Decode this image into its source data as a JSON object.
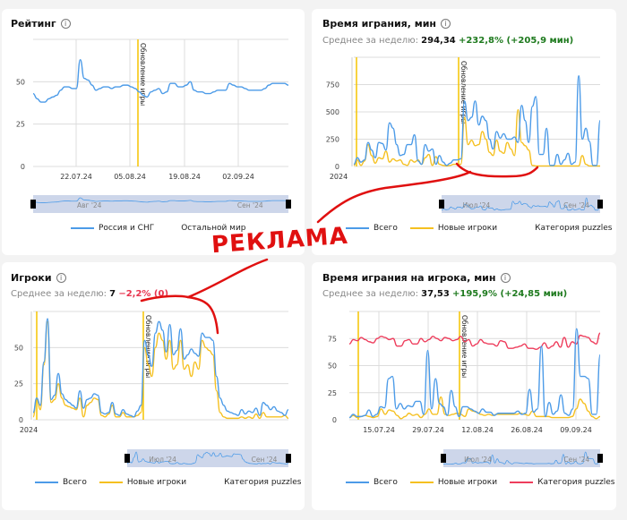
{
  "colors": {
    "total": "#4c9be8",
    "new": "#f5c020",
    "puzzles": "#ee3d5c",
    "update": "#f5c400",
    "grid": "#dcdcdc",
    "nav": "#cdd6ea",
    "annotation": "#e01010"
  },
  "annotation": "РЕКЛАМА",
  "update_label": "Обновление игры",
  "panels": [
    {
      "title": "Рейтинг",
      "legend": [
        "Россия и СНГ",
        "Остальной мир"
      ]
    },
    {
      "title": "Время играния, мин",
      "avg_label": "Среднее за неделю:",
      "avg_value": "294,34",
      "avg_change": "+232,8% (+205,9 мин)",
      "legend": [
        "Всего",
        "Новые игроки",
        "Категория puzzles"
      ]
    },
    {
      "title": "Игроки",
      "avg_label": "Среднее за неделю:",
      "avg_value": "7",
      "avg_change": "−2,2% (0)",
      "legend": [
        "Всего",
        "Новые игроки",
        "Категория puzzles"
      ]
    },
    {
      "title": "Время играния на игрока, мин",
      "avg_label": "Среднее за неделю:",
      "avg_value": "37,53",
      "avg_change": "+195,9% (+24,85 мин)",
      "legend": [
        "Всего",
        "Новые игроки",
        "Категория puzzles"
      ]
    }
  ],
  "chart_data": [
    {
      "type": "line",
      "title": "Рейтинг",
      "ylim": [
        0,
        75
      ],
      "yticks": [
        0,
        25,
        50
      ],
      "xticks": [
        "22.07.24",
        "05.08.24",
        "19.08.24",
        "02.09.24"
      ],
      "nav_labels": [
        "Авг '24",
        "Сен '24"
      ],
      "x_start_label": "",
      "series": [
        {
          "name": "Россия и СНГ",
          "color": "total",
          "values": [
            43,
            40,
            38,
            38,
            40,
            41,
            42,
            45,
            47,
            47,
            46,
            46,
            63,
            52,
            51,
            48,
            45,
            46,
            47,
            47,
            46,
            47,
            47,
            48,
            48,
            47,
            46,
            44,
            42,
            41,
            44,
            45,
            46,
            43,
            44,
            49,
            49,
            47,
            47,
            48,
            50,
            45,
            44,
            44,
            43,
            43,
            44,
            45,
            45,
            45,
            49,
            48,
            47,
            47,
            46,
            45,
            45,
            45,
            45,
            46,
            48,
            49,
            49,
            49,
            49,
            48
          ]
        }
      ]
    },
    {
      "type": "line",
      "title": "Время играния, мин",
      "ylim": [
        0,
        1000
      ],
      "yticks": [
        0,
        250,
        500,
        750
      ],
      "xticks": [],
      "nav_labels": [
        "Июл '24",
        "Сен '24"
      ],
      "x_start_label": "2024",
      "series": [
        {
          "name": "Всего",
          "color": "total",
          "values": [
            20,
            80,
            40,
            60,
            220,
            150,
            80,
            220,
            210,
            150,
            400,
            350,
            200,
            100,
            110,
            200,
            200,
            290,
            50,
            20,
            200,
            140,
            160,
            20,
            100,
            40,
            10,
            30,
            60,
            60,
            70,
            600,
            420,
            450,
            600,
            380,
            460,
            420,
            250,
            160,
            320,
            260,
            300,
            250,
            250,
            270,
            220,
            560,
            420,
            220,
            550,
            640,
            110,
            110,
            350,
            10,
            10,
            110,
            20,
            60,
            120,
            20,
            40,
            830,
            250,
            350,
            230,
            10,
            10,
            420
          ]
        },
        {
          "name": "Новые игроки",
          "color": "new",
          "values": [
            10,
            60,
            10,
            50,
            200,
            100,
            30,
            80,
            70,
            140,
            40,
            70,
            50,
            60,
            20,
            10,
            60,
            40,
            60,
            20,
            80,
            110,
            10,
            90,
            20,
            10,
            5,
            10,
            20,
            20,
            20,
            450,
            200,
            240,
            190,
            200,
            320,
            250,
            130,
            100,
            240,
            140,
            120,
            220,
            160,
            100,
            520,
            220,
            190,
            150,
            10,
            5,
            5,
            5,
            5,
            5,
            5,
            5,
            5,
            5,
            5,
            5,
            5,
            5,
            100,
            20,
            5,
            5,
            5,
            5
          ]
        }
      ]
    },
    {
      "type": "line",
      "title": "Игроки",
      "ylim": [
        0,
        75
      ],
      "yticks": [
        0,
        25,
        50
      ],
      "xticks": [],
      "nav_labels": [
        "Июл '24",
        "Сен '24"
      ],
      "x_start_label": "2024",
      "series": [
        {
          "name": "Всего",
          "color": "total",
          "values": [
            5,
            15,
            10,
            40,
            70,
            14,
            17,
            32,
            18,
            14,
            12,
            10,
            8,
            20,
            8,
            14,
            15,
            18,
            17,
            5,
            4,
            5,
            12,
            4,
            3,
            7,
            4,
            3,
            2,
            6,
            10,
            55,
            45,
            37,
            60,
            68,
            62,
            47,
            66,
            45,
            48,
            63,
            42,
            45,
            49,
            46,
            44,
            60,
            57,
            57,
            55,
            30,
            15,
            10,
            6,
            5,
            4,
            3,
            7,
            4,
            6,
            5,
            8,
            3,
            12,
            10,
            7,
            9,
            6,
            5,
            3,
            7
          ]
        },
        {
          "name": "Новые игроки",
          "color": "new",
          "values": [
            2,
            15,
            7,
            38,
            68,
            12,
            14,
            25,
            15,
            10,
            9,
            8,
            7,
            15,
            2,
            10,
            12,
            15,
            14,
            3,
            2,
            4,
            10,
            2,
            2,
            5,
            2,
            2,
            2,
            3,
            5,
            50,
            38,
            30,
            50,
            60,
            55,
            42,
            55,
            35,
            38,
            55,
            35,
            38,
            30,
            40,
            35,
            55,
            50,
            48,
            45,
            20,
            5,
            2,
            1,
            1,
            1,
            1,
            2,
            1,
            2,
            1,
            4,
            1,
            5,
            2,
            2,
            2,
            2,
            2,
            3,
            1
          ]
        }
      ]
    },
    {
      "type": "line",
      "title": "Время играния на игрока, мин",
      "ylim": [
        0,
        100
      ],
      "yticks": [
        0,
        25,
        50,
        75
      ],
      "xticks": [
        "15.07.24",
        "29.07.24",
        "12.08.24",
        "26.08.24",
        "09.09.24"
      ],
      "nav_labels": [
        "Июл '24",
        "Сен '24"
      ],
      "x_start_label": "",
      "series": [
        {
          "name": "Всего",
          "color": "total",
          "values": [
            2,
            5,
            3,
            3,
            4,
            9,
            3,
            5,
            12,
            11,
            38,
            40,
            10,
            15,
            10,
            13,
            12,
            17,
            17,
            5,
            64,
            10,
            38,
            15,
            12,
            4,
            27,
            12,
            3,
            12,
            12,
            10,
            8,
            6,
            10,
            7,
            7,
            4,
            6,
            6,
            6,
            6,
            6,
            8,
            5,
            6,
            28,
            7,
            10,
            68,
            3,
            16,
            5,
            8,
            23,
            6,
            4,
            10,
            84,
            40,
            40,
            38,
            5,
            5,
            60
          ]
        },
        {
          "name": "Новые игроки",
          "color": "new",
          "values": [
            2,
            4,
            2,
            3,
            4,
            3,
            2,
            3,
            10,
            5,
            9,
            8,
            4,
            1,
            3,
            6,
            4,
            5,
            2,
            5,
            10,
            5,
            5,
            21,
            5,
            4,
            5,
            6,
            5,
            3,
            10,
            8,
            7,
            5,
            4,
            5,
            4,
            5,
            5,
            5,
            5,
            5,
            5,
            6,
            5,
            4,
            8,
            3,
            3,
            3,
            3,
            2,
            2,
            2,
            2,
            2,
            3,
            10,
            19,
            15,
            8,
            3,
            1,
            3
          ]
        },
        {
          "name": "Категория puzzles",
          "color": "puzzles",
          "values": [
            70,
            74,
            73,
            76,
            74,
            72,
            71,
            75,
            77,
            76,
            74,
            75,
            68,
            68,
            73,
            74,
            70,
            70,
            75,
            72,
            74,
            77,
            75,
            73,
            76,
            75,
            73,
            74,
            77,
            72,
            74,
            68,
            70,
            74,
            71,
            70,
            70,
            68,
            73,
            72,
            66,
            66,
            67,
            68,
            70,
            66,
            66,
            65,
            67,
            71,
            66,
            68,
            72,
            67,
            76,
            67,
            72,
            70,
            78,
            77,
            76,
            72,
            70,
            80
          ]
        }
      ]
    }
  ]
}
